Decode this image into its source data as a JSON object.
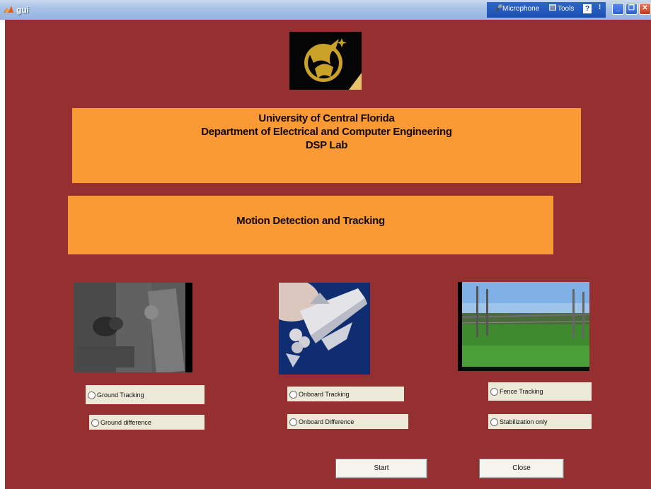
{
  "window": {
    "title": "gui",
    "toolbar_items": {
      "microphone": "Microphone",
      "tools": "Tools",
      "help": "?"
    }
  },
  "colors": {
    "background": "#962f2f",
    "banner": "#fa9a35",
    "control": "#ece9d8"
  },
  "header": {
    "line1": "University of Central Florida",
    "line2": "Department of Electrical and Computer Engineering",
    "line3": "DSP Lab"
  },
  "subtitle": "Motion Detection and Tracking",
  "options": {
    "ground_tracking": "Ground Tracking",
    "ground_difference": "Ground difference",
    "onboard_tracking": "Onboard Tracking",
    "onboard_difference": "Onboard Difference",
    "fence_tracking": "Fence Tracking",
    "stabilization_only": "Stabilization only"
  },
  "buttons": {
    "start": "Start",
    "close": "Close"
  }
}
